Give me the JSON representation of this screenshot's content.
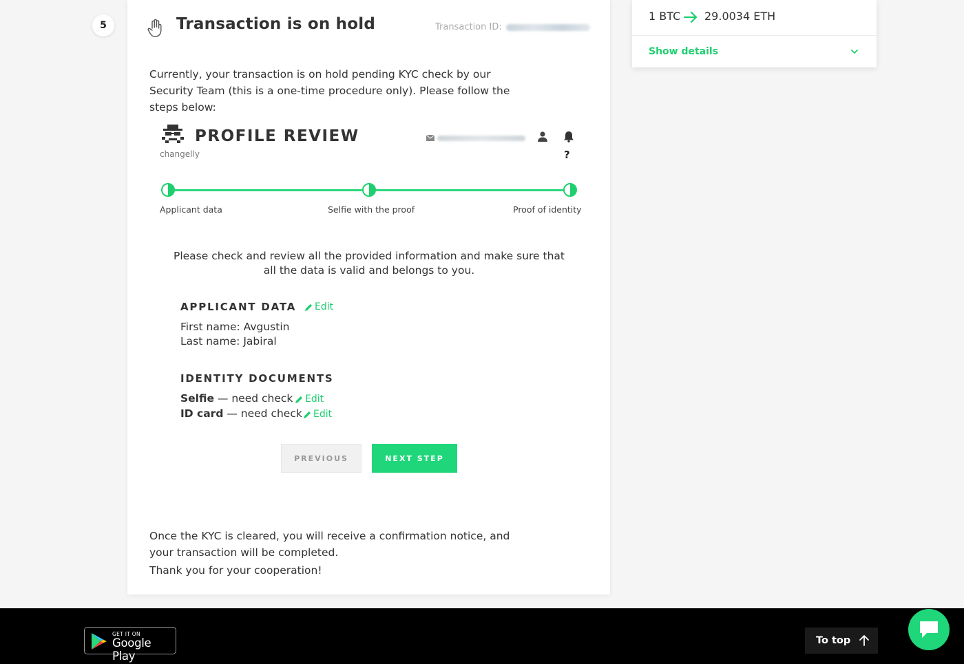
{
  "step": {
    "number": "5"
  },
  "card": {
    "title": "Transaction is on hold",
    "tx_label": "Transaction ID:",
    "intro": "Currently, your transaction is on hold pending KYC check by our Security Team (this is a one-time procedure only). Please follow the steps below:",
    "outro": "Once the KYC is cleared, you will receive a confirmation notice, and your transaction will be completed.",
    "thanks": "Thank you for your cooperation!"
  },
  "profile_review": {
    "title": "PROFILE REVIEW",
    "brand": "changelly",
    "help": "?",
    "steps": [
      "Applicant data",
      "Selfie with the proof",
      "Proof of identity"
    ],
    "check_text": "Please check and review all the provided information and make sure that all the data is valid and belongs to you.",
    "applicant": {
      "heading": "APPLICANT DATA",
      "edit": "Edit",
      "first_name": "First name: Avgustin",
      "last_name": "Last name: Jabiral"
    },
    "identity": {
      "heading": "IDENTITY DOCUMENTS",
      "selfie_label": "Selfie",
      "selfie_status": " — need check",
      "id_label": "ID card",
      "id_status": " — need check",
      "edit": "Edit"
    },
    "buttons": {
      "previous": "PREVIOUS",
      "next": "NEXT STEP"
    }
  },
  "side": {
    "from": "1 BTC",
    "to": "29.0034 ETH",
    "show_details": "Show details"
  },
  "footer": {
    "gplay_small": "GET IT ON",
    "gplay_big": "Google Play",
    "to_top": "To top"
  },
  "colors": {
    "accent": "#1fd67a",
    "text": "#333333",
    "footer": "#000000"
  }
}
